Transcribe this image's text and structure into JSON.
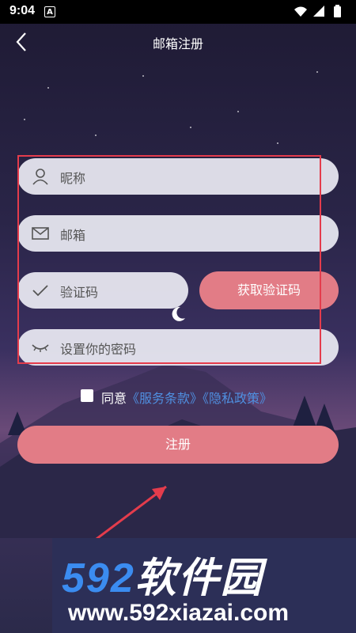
{
  "status": {
    "time": "9:04",
    "notif_glyph": "A"
  },
  "header": {
    "title": "邮箱注册"
  },
  "form": {
    "nickname_placeholder": "昵称",
    "email_placeholder": "邮箱",
    "code_placeholder": "验证码",
    "get_code_label": "获取验证码",
    "password_placeholder": "设置你的密码"
  },
  "agree": {
    "prefix": "同意",
    "terms": "《服务条款》",
    "privacy": "《隐私政策》"
  },
  "register_label": "注册",
  "watermark": {
    "number": "592",
    "name": "软件园",
    "url": "www.592xiazai.com"
  },
  "colors": {
    "accent": "#e27c86",
    "link": "#4f8fe0",
    "highlight_box": "#e43c4c"
  }
}
